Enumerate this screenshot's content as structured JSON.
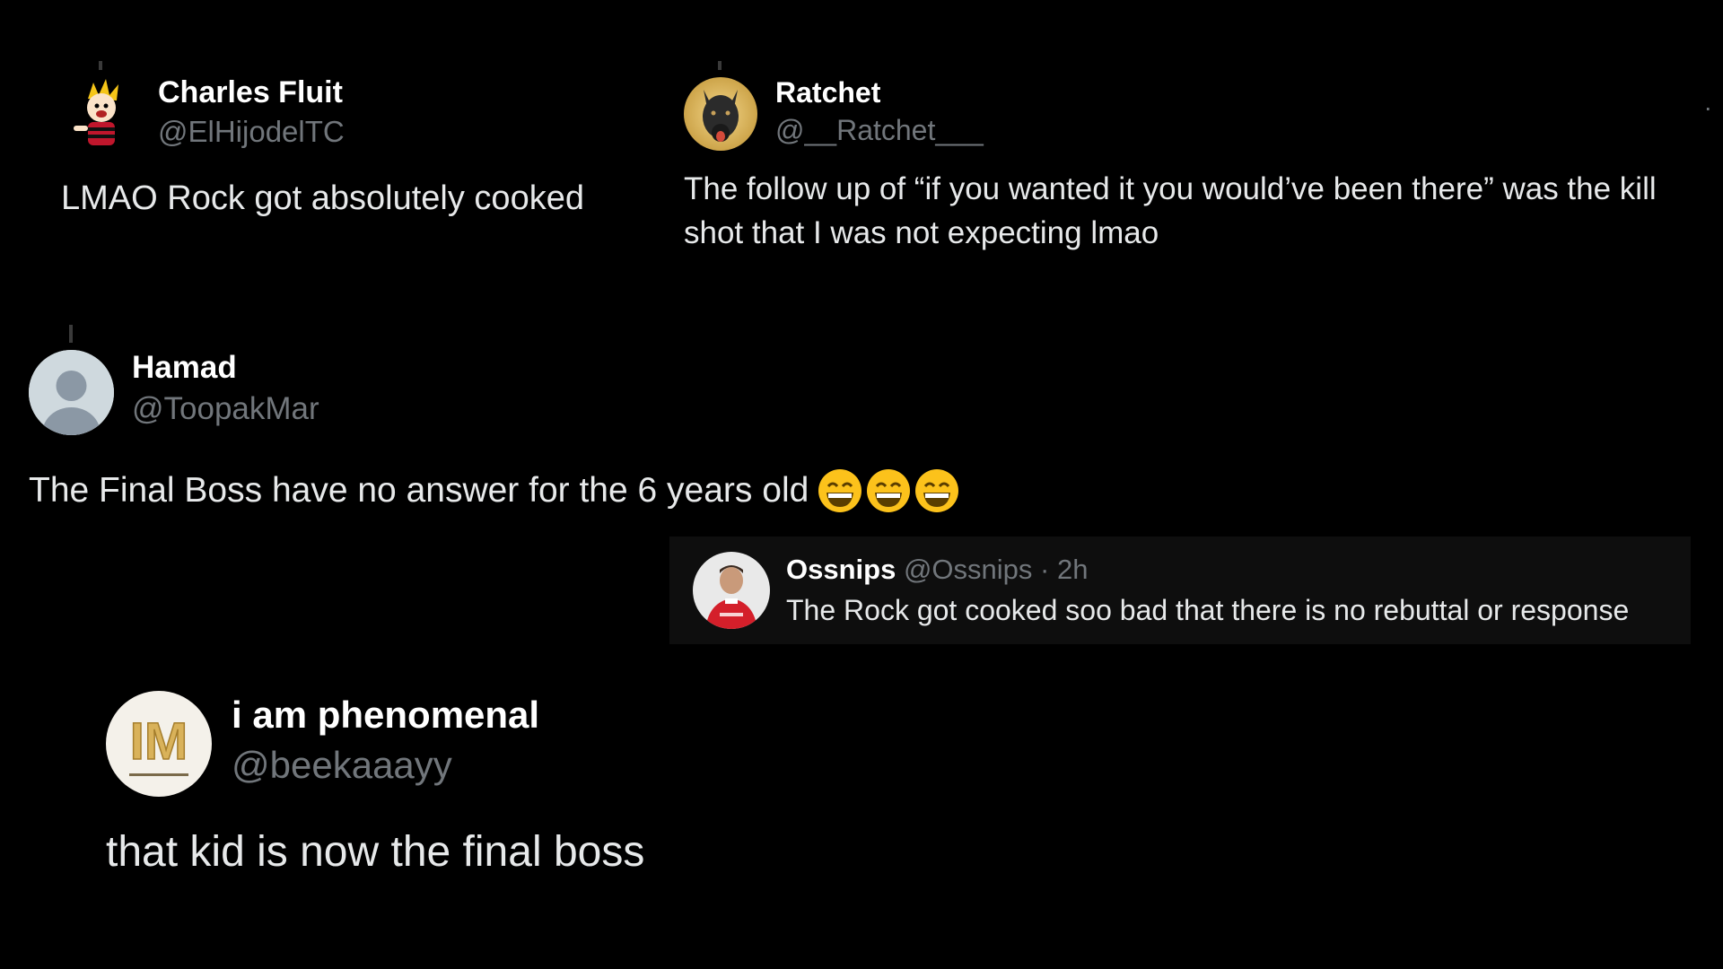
{
  "tweets": {
    "charles": {
      "name": "Charles Fluit",
      "handle": "@ElHijodelTC",
      "text": "LMAO Rock got absolutely cooked"
    },
    "ratchet": {
      "name": "Ratchet",
      "handle": "@__Ratchet___",
      "text": "The follow up of “if you wanted it you would’ve been there” was the kill shot that I was not expecting lmao",
      "more": "·"
    },
    "hamad": {
      "name": "Hamad",
      "handle": "@ToopakMar",
      "text": "The Final Boss have no answer for the 6 years old",
      "emojis": [
        "grinning-face-emoji",
        "grinning-face-emoji",
        "grinning-face-emoji"
      ]
    },
    "ossnips": {
      "name": "Ossnips",
      "handle": "@Ossnips",
      "separator": "·",
      "time": "2h",
      "text": "The Rock got cooked soo bad that there is no rebuttal or response"
    },
    "phenomenal": {
      "name": "i am phenomenal",
      "handle": "@beekaaayy",
      "text": "that kid is now the final boss",
      "avatar_text": "IM"
    }
  },
  "colors": {
    "background": "#000000",
    "name": "#ffffff",
    "handle": "#71767b",
    "body": "#e7e9ea",
    "quote_background": "#0e0e0e"
  }
}
